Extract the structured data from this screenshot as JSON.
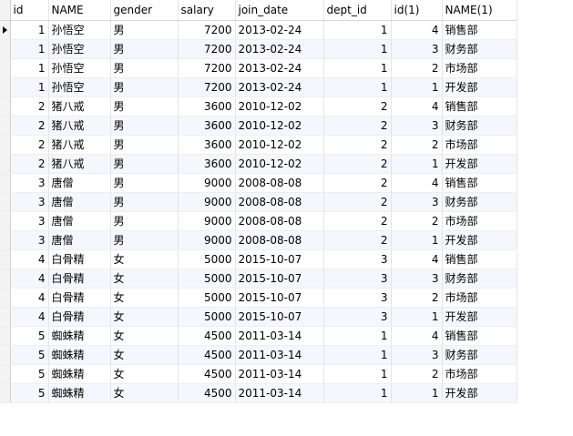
{
  "grid": {
    "columns": [
      "id",
      "NAME",
      "gender",
      "salary",
      "join_date",
      "dept_id",
      "id(1)",
      "NAME(1)"
    ],
    "rows": [
      [
        "1",
        "孙悟空",
        "男",
        "7200",
        "2013-02-24",
        "1",
        "4",
        "销售部"
      ],
      [
        "1",
        "孙悟空",
        "男",
        "7200",
        "2013-02-24",
        "1",
        "3",
        "财务部"
      ],
      [
        "1",
        "孙悟空",
        "男",
        "7200",
        "2013-02-24",
        "1",
        "2",
        "市场部"
      ],
      [
        "1",
        "孙悟空",
        "男",
        "7200",
        "2013-02-24",
        "1",
        "1",
        "开发部"
      ],
      [
        "2",
        "猪八戒",
        "男",
        "3600",
        "2010-12-02",
        "2",
        "4",
        "销售部"
      ],
      [
        "2",
        "猪八戒",
        "男",
        "3600",
        "2010-12-02",
        "2",
        "3",
        "财务部"
      ],
      [
        "2",
        "猪八戒",
        "男",
        "3600",
        "2010-12-02",
        "2",
        "2",
        "市场部"
      ],
      [
        "2",
        "猪八戒",
        "男",
        "3600",
        "2010-12-02",
        "2",
        "1",
        "开发部"
      ],
      [
        "3",
        "唐僧",
        "男",
        "9000",
        "2008-08-08",
        "2",
        "4",
        "销售部"
      ],
      [
        "3",
        "唐僧",
        "男",
        "9000",
        "2008-08-08",
        "2",
        "3",
        "财务部"
      ],
      [
        "3",
        "唐僧",
        "男",
        "9000",
        "2008-08-08",
        "2",
        "2",
        "市场部"
      ],
      [
        "3",
        "唐僧",
        "男",
        "9000",
        "2008-08-08",
        "2",
        "1",
        "开发部"
      ],
      [
        "4",
        "白骨精",
        "女",
        "5000",
        "2015-10-07",
        "3",
        "4",
        "销售部"
      ],
      [
        "4",
        "白骨精",
        "女",
        "5000",
        "2015-10-07",
        "3",
        "3",
        "财务部"
      ],
      [
        "4",
        "白骨精",
        "女",
        "5000",
        "2015-10-07",
        "3",
        "2",
        "市场部"
      ],
      [
        "4",
        "白骨精",
        "女",
        "5000",
        "2015-10-07",
        "3",
        "1",
        "开发部"
      ],
      [
        "5",
        "蜘蛛精",
        "女",
        "4500",
        "2011-03-14",
        "1",
        "4",
        "销售部"
      ],
      [
        "5",
        "蜘蛛精",
        "女",
        "4500",
        "2011-03-14",
        "1",
        "3",
        "财务部"
      ],
      [
        "5",
        "蜘蛛精",
        "女",
        "4500",
        "2011-03-14",
        "1",
        "2",
        "市场部"
      ],
      [
        "5",
        "蜘蛛精",
        "女",
        "4500",
        "2011-03-14",
        "1",
        "1",
        "开发部"
      ]
    ],
    "current_row_marker": "row-pointer-icon",
    "alt_row_color": "#f4f7fd"
  }
}
